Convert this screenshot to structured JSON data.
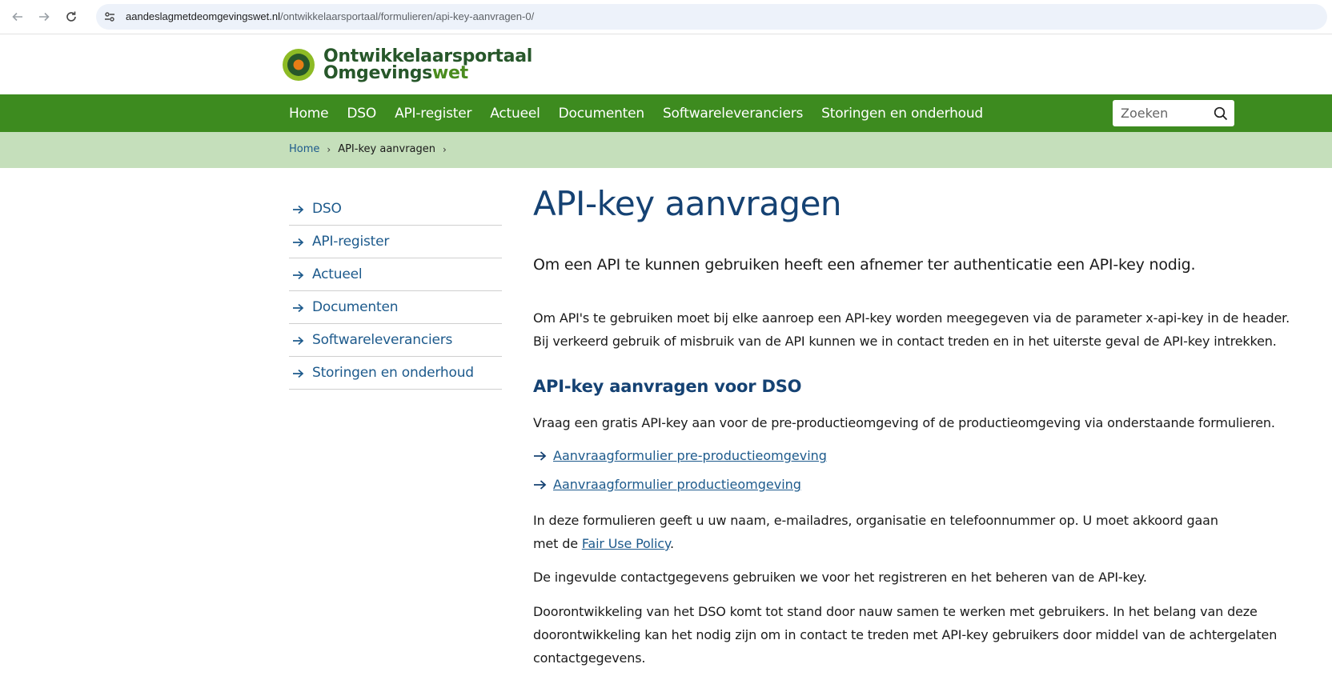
{
  "browser": {
    "url_host": "aandeslagmetdeomgevingswet.nl",
    "url_path": "/ontwikkelaarsportaal/formulieren/api-key-aanvragen-0/"
  },
  "logo": {
    "line1": "Ontwikkelaarsportaal",
    "line2_part1": "Omgevings",
    "line2_part2": "wet"
  },
  "nav": {
    "items": [
      "Home",
      "DSO",
      "API-register",
      "Actueel",
      "Documenten",
      "Softwareleveranciers",
      "Storingen en onderhoud"
    ],
    "search_placeholder": "Zoeken"
  },
  "breadcrumb": {
    "home": "Home",
    "current": "API-key aanvragen"
  },
  "sidebar": {
    "items": [
      "DSO",
      "API-register",
      "Actueel",
      "Documenten",
      "Softwareleveranciers",
      "Storingen en onderhoud"
    ]
  },
  "content": {
    "title": "API-key aanvragen",
    "lead": "Om een API te kunnen gebruiken heeft een afnemer ter authenticatie een API-key nodig.",
    "intro_line1": "Om API's te gebruiken moet bij elke aanroep een API-key worden meegegeven via de parameter x-api-key in de header.",
    "intro_line2": "Bij verkeerd gebruik of misbruik van de API kunnen we in contact treden en in het uiterste geval de API-key intrekken.",
    "section_heading": "API-key aanvragen voor DSO",
    "section_intro": "Vraag een gratis API-key aan voor de pre-productieomgeving of de productieomgeving via onderstaande formulieren.",
    "link_preprod": "Aanvraagformulier pre-productieomgeving",
    "link_prod": "Aanvraagformulier productieomgeving",
    "forms_line1": "In deze formulieren geeft u uw naam, e-mailadres, organisatie en telefoonnummer op. U moet akkoord gaan",
    "forms_line2_prefix": "met de ",
    "fair_use_link": "Fair Use Policy",
    "forms_line2_suffix": ".",
    "contact_usage": "De ingevulde contactgegevens gebruiken we voor het registreren en het beheren van de API-key.",
    "dev_line1": "Doorontwikkeling van het DSO komt tot stand door nauw samen te werken met gebruikers. In het belang van deze",
    "dev_line2": "doorontwikkeling kan het nodig zijn om in contact te treden met API-key gebruikers door middel van de achtergelaten",
    "dev_line3": "contactgegevens."
  },
  "colors": {
    "nav_green": "#3d8b1f",
    "breadcrumb_green": "#c5dfbb",
    "heading_blue": "#154273",
    "link_blue": "#1d5a8c"
  }
}
